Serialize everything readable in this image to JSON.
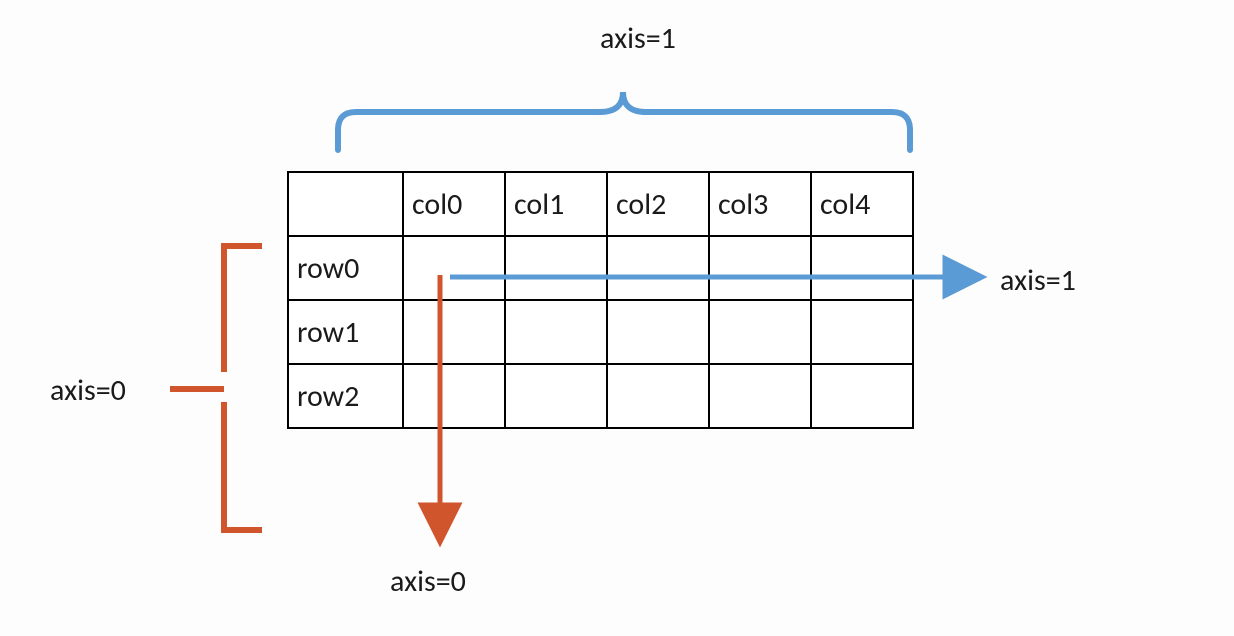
{
  "labels": {
    "axis1_top": "axis=1",
    "axis1_right": "axis=1",
    "axis0_left": "axis=0",
    "axis0_bottom": "axis=0"
  },
  "columns": [
    "col0",
    "col1",
    "col2",
    "col3",
    "col4"
  ],
  "rows": [
    "row0",
    "row1",
    "row2"
  ],
  "colors": {
    "axis0": "#d1552c",
    "axis1": "#5b9bd5",
    "border": "#000000"
  }
}
